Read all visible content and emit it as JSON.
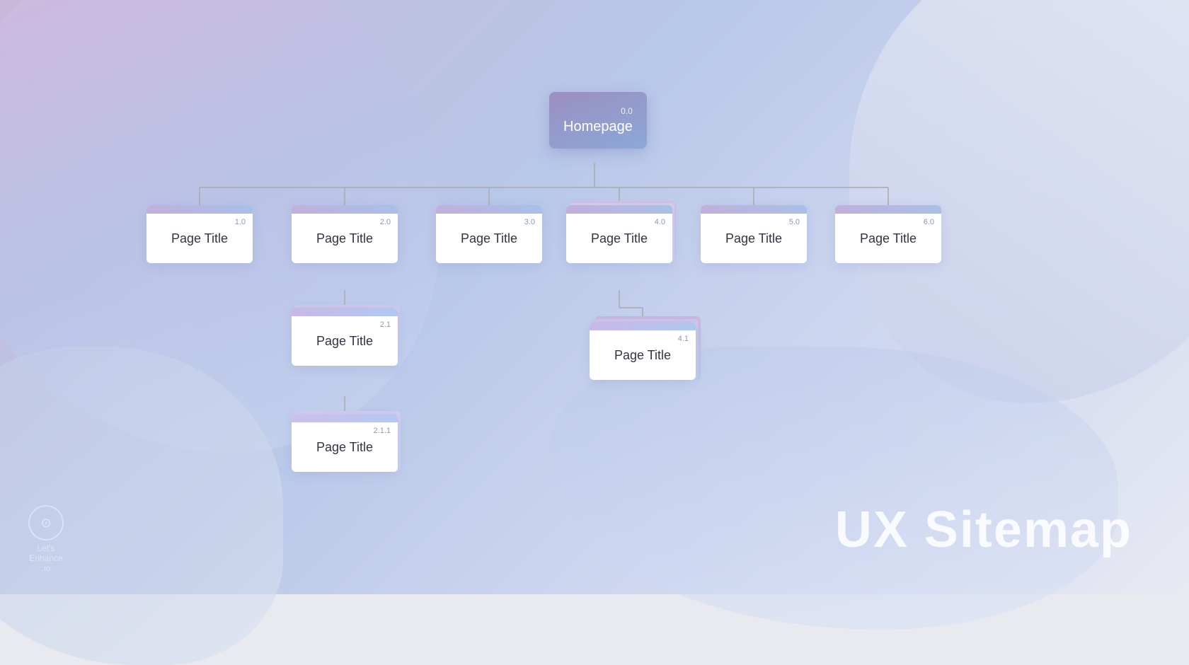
{
  "title": "UX Sitemap",
  "logo": {
    "line1": "Let's",
    "line2": "Enhance",
    "line3": ".io"
  },
  "nodes": {
    "homepage": {
      "number": "0.0",
      "label": "Homepage"
    },
    "n1": {
      "number": "1.0",
      "label": "Page Title"
    },
    "n2": {
      "number": "2.0",
      "label": "Page Title"
    },
    "n3": {
      "number": "3.0",
      "label": "Page Title"
    },
    "n4": {
      "number": "4.0",
      "label": "Page Title"
    },
    "n5": {
      "number": "5.0",
      "label": "Page Title"
    },
    "n6": {
      "number": "6.0",
      "label": "Page Title"
    },
    "n21": {
      "number": "2.1",
      "label": "Page Title"
    },
    "n211": {
      "number": "2.1.1",
      "label": "Page Title"
    },
    "n41": {
      "number": "4.1",
      "label": "Page Title"
    }
  }
}
